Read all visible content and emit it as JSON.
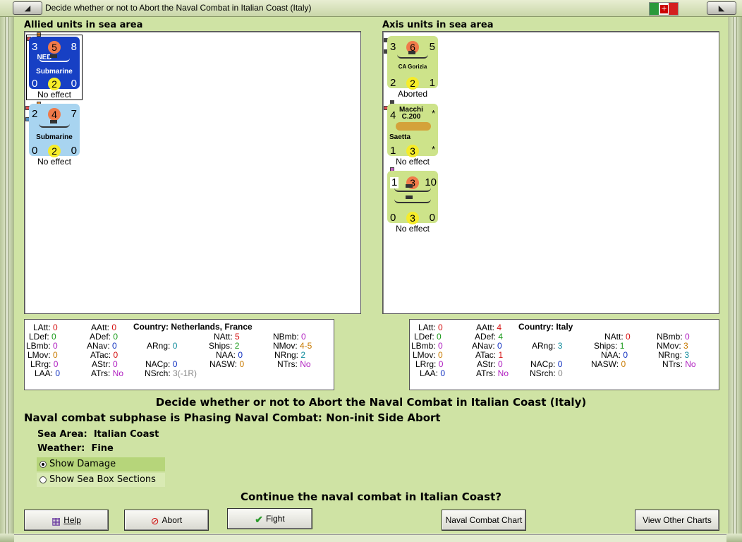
{
  "window": {
    "title": "Decide whether or not to Abort the Naval Combat in Italian Coast (Italy)",
    "left_icon": "restore-icon",
    "right_icon": "collapse-icon",
    "flag_icon": "italy-flag-icon"
  },
  "allied": {
    "header": "Allied units in sea area",
    "units": [
      {
        "top_left": "3",
        "top_mid": "5",
        "top_right": "8",
        "country": "NED",
        "type": "Submarine",
        "bot_left": "0",
        "bot_mid": "2",
        "bot_right": "0",
        "status": "No effect",
        "color": "#1740c4"
      },
      {
        "top_left": "2",
        "top_mid": "4",
        "top_right": "7",
        "type": "Submarine",
        "bot_left": "0",
        "bot_mid": "2",
        "bot_right": "0",
        "status": "No effect",
        "color": "#a8d4f0"
      }
    ],
    "stats": {
      "latt": "0",
      "aatt": "0",
      "ldef": "0",
      "adef": "0",
      "lbmb": "0",
      "anav": "0",
      "lmov": "0",
      "atac": "0",
      "lrg": "0",
      "astr": "0",
      "laa": "0",
      "atrs": "No",
      "natt": "5",
      "nbmb": "0",
      "arng": "0",
      "ships": "2",
      "nmov": "4-5",
      "naa": "0",
      "nrng": "2",
      "nacp": "0",
      "nasw": "0",
      "ntrs": "No",
      "nsrch": "3(-1R)"
    },
    "country": "Country: Netherlands, France"
  },
  "axis": {
    "header": "Axis units in sea area",
    "units": [
      {
        "top_left": "3",
        "top_mid": "6",
        "top_right": "5",
        "name": "CA Gorizia",
        "bot_left": "2",
        "bot_mid": "2",
        "bot_right": "1",
        "status": "Aborted",
        "color": "#cde38a"
      },
      {
        "top_left": "4",
        "top_name": "Macchi C.200",
        "top_right": "*",
        "name": "Saetta",
        "bot_left": "1",
        "bot_mid": "3",
        "bot_right": "*",
        "status": "No effect",
        "color": "#cde38a"
      },
      {
        "top_left": "1",
        "top_mid": "3",
        "top_right": "10",
        "bot_left": "0",
        "bot_mid": "3",
        "bot_right": "0",
        "status": "No effect",
        "color": "#cde38a"
      }
    ],
    "stats": {
      "latt": "0",
      "aatt": "4",
      "ldef": "0",
      "adef": "4",
      "lbmb": "0",
      "anav": "0",
      "lmov": "0",
      "atac": "1",
      "lrg": "0",
      "astr": "0",
      "laa": "0",
      "atrs": "No",
      "natt": "0",
      "nbmb": "0",
      "arng": "3",
      "ships": "1",
      "nmov": "3",
      "naa": "0",
      "nrng": "3",
      "nacp": "0",
      "nasw": "0",
      "ntrs": "No",
      "nsrch": "0"
    },
    "country": "Country: Italy"
  },
  "stat_labels": {
    "latt": "LAtt:",
    "aatt": "AAtt:",
    "ldef": "LDef:",
    "adef": "ADef:",
    "lbmb": "LBmb:",
    "anav": "ANav:",
    "lmov": "LMov:",
    "atac": "ATac:",
    "lrg": "LRrg:",
    "astr": "AStr:",
    "laa": "LAA:",
    "atrs": "ATrs:",
    "natt": "NAtt:",
    "nbmb": "NBmb:",
    "arng": "ARng:",
    "ships": "Ships:",
    "nmov": "NMov:",
    "naa": "NAA:",
    "nrng": "NRng:",
    "nacp": "NACp:",
    "nasw": "NASW:",
    "ntrs": "NTrs:",
    "nsrch": "NSrch:"
  },
  "main": {
    "heading": "Decide whether or not to Abort the Naval Combat in Italian Coast (Italy)",
    "subphase": "Naval combat subphase is Phasing Naval Combat: Non-init Side Abort",
    "sea_area_label": "Sea Area:",
    "sea_area_value": "Italian Coast",
    "weather_label": "Weather:",
    "weather_value": "Fine",
    "options": [
      {
        "label": "Show Damage",
        "selected": true
      },
      {
        "label": "Show Sea Box Sections",
        "selected": false
      }
    ],
    "question": "Continue the naval combat in Italian Coast?"
  },
  "buttons": {
    "help": "Help",
    "abort": "Abort",
    "fight": "Fight",
    "naval_chart": "Naval Combat Chart",
    "other_charts": "View Other Charts"
  }
}
